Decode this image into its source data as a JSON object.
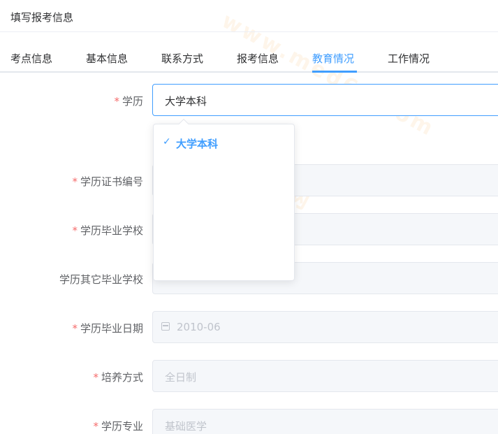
{
  "header": {
    "title": "填写报考信息"
  },
  "tabs": [
    {
      "label": "考点信息",
      "active": false
    },
    {
      "label": "基本信息",
      "active": false
    },
    {
      "label": "联系方式",
      "active": false
    },
    {
      "label": "报考信息",
      "active": false
    },
    {
      "label": "教育情况",
      "active": true
    },
    {
      "label": "工作情况",
      "active": false
    }
  ],
  "form": {
    "education": {
      "label": "学历",
      "required": true,
      "value": "大学本科"
    },
    "cert_no": {
      "label": "学历证书编号",
      "required": true,
      "value": ""
    },
    "school": {
      "label": "学历毕业学校",
      "required": true,
      "value": ""
    },
    "other_school": {
      "label": "学历其它毕业学校",
      "required": false,
      "value": ""
    },
    "grad_date": {
      "label": "学历毕业日期",
      "required": true,
      "value": "2010-06"
    },
    "study_mode": {
      "label": "培养方式",
      "required": true,
      "value": "全日制"
    },
    "major": {
      "label": "学历专业",
      "required": true,
      "value": "基础医学"
    }
  },
  "dropdown": {
    "options": [
      {
        "label": "大学本科",
        "selected": true
      }
    ]
  },
  "watermark": {
    "text_cn": "医学教育网",
    "text_en": "www.med66.com"
  },
  "colors": {
    "accent": "#409eff",
    "required": "#f56c6c",
    "watermark": "#f5aa50"
  }
}
